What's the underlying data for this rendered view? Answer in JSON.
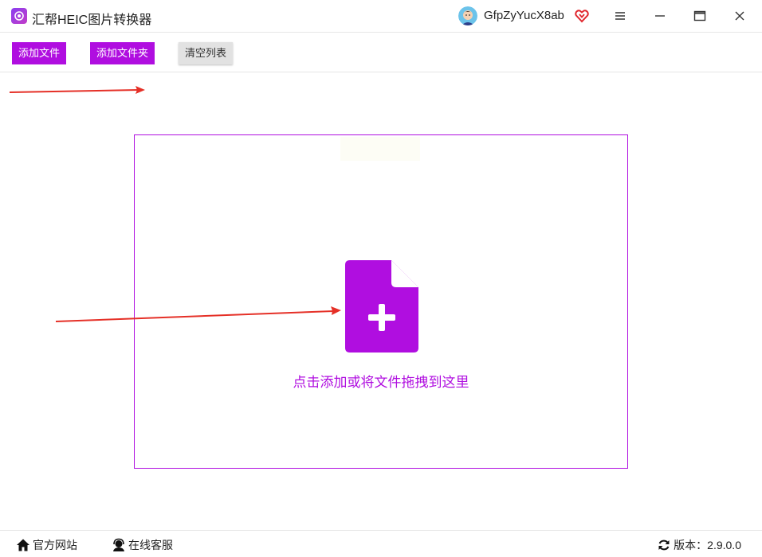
{
  "app": {
    "title": "汇帮HEIC图片转换器"
  },
  "user": {
    "name": "GfpZyYucX8ab"
  },
  "toolbar": {
    "add_file": "添加文件",
    "add_folder": "添加文件夹",
    "clear_list": "清空列表"
  },
  "dropzone": {
    "hint": "点击添加或将文件拖拽到这里"
  },
  "footer": {
    "official_site": "官方网站",
    "online_service": "在线客服",
    "version_label": "版本：",
    "version_value": "2.9.0.0"
  },
  "colors": {
    "accent": "#b00ee0",
    "arrow": "#e53027"
  },
  "icons": [
    "app-logo-icon",
    "avatar",
    "vip-heart-icon",
    "menu-icon",
    "minimize-icon",
    "maximize-icon",
    "close-icon",
    "add-file-icon",
    "home-icon",
    "headset-icon",
    "refresh-icon"
  ]
}
